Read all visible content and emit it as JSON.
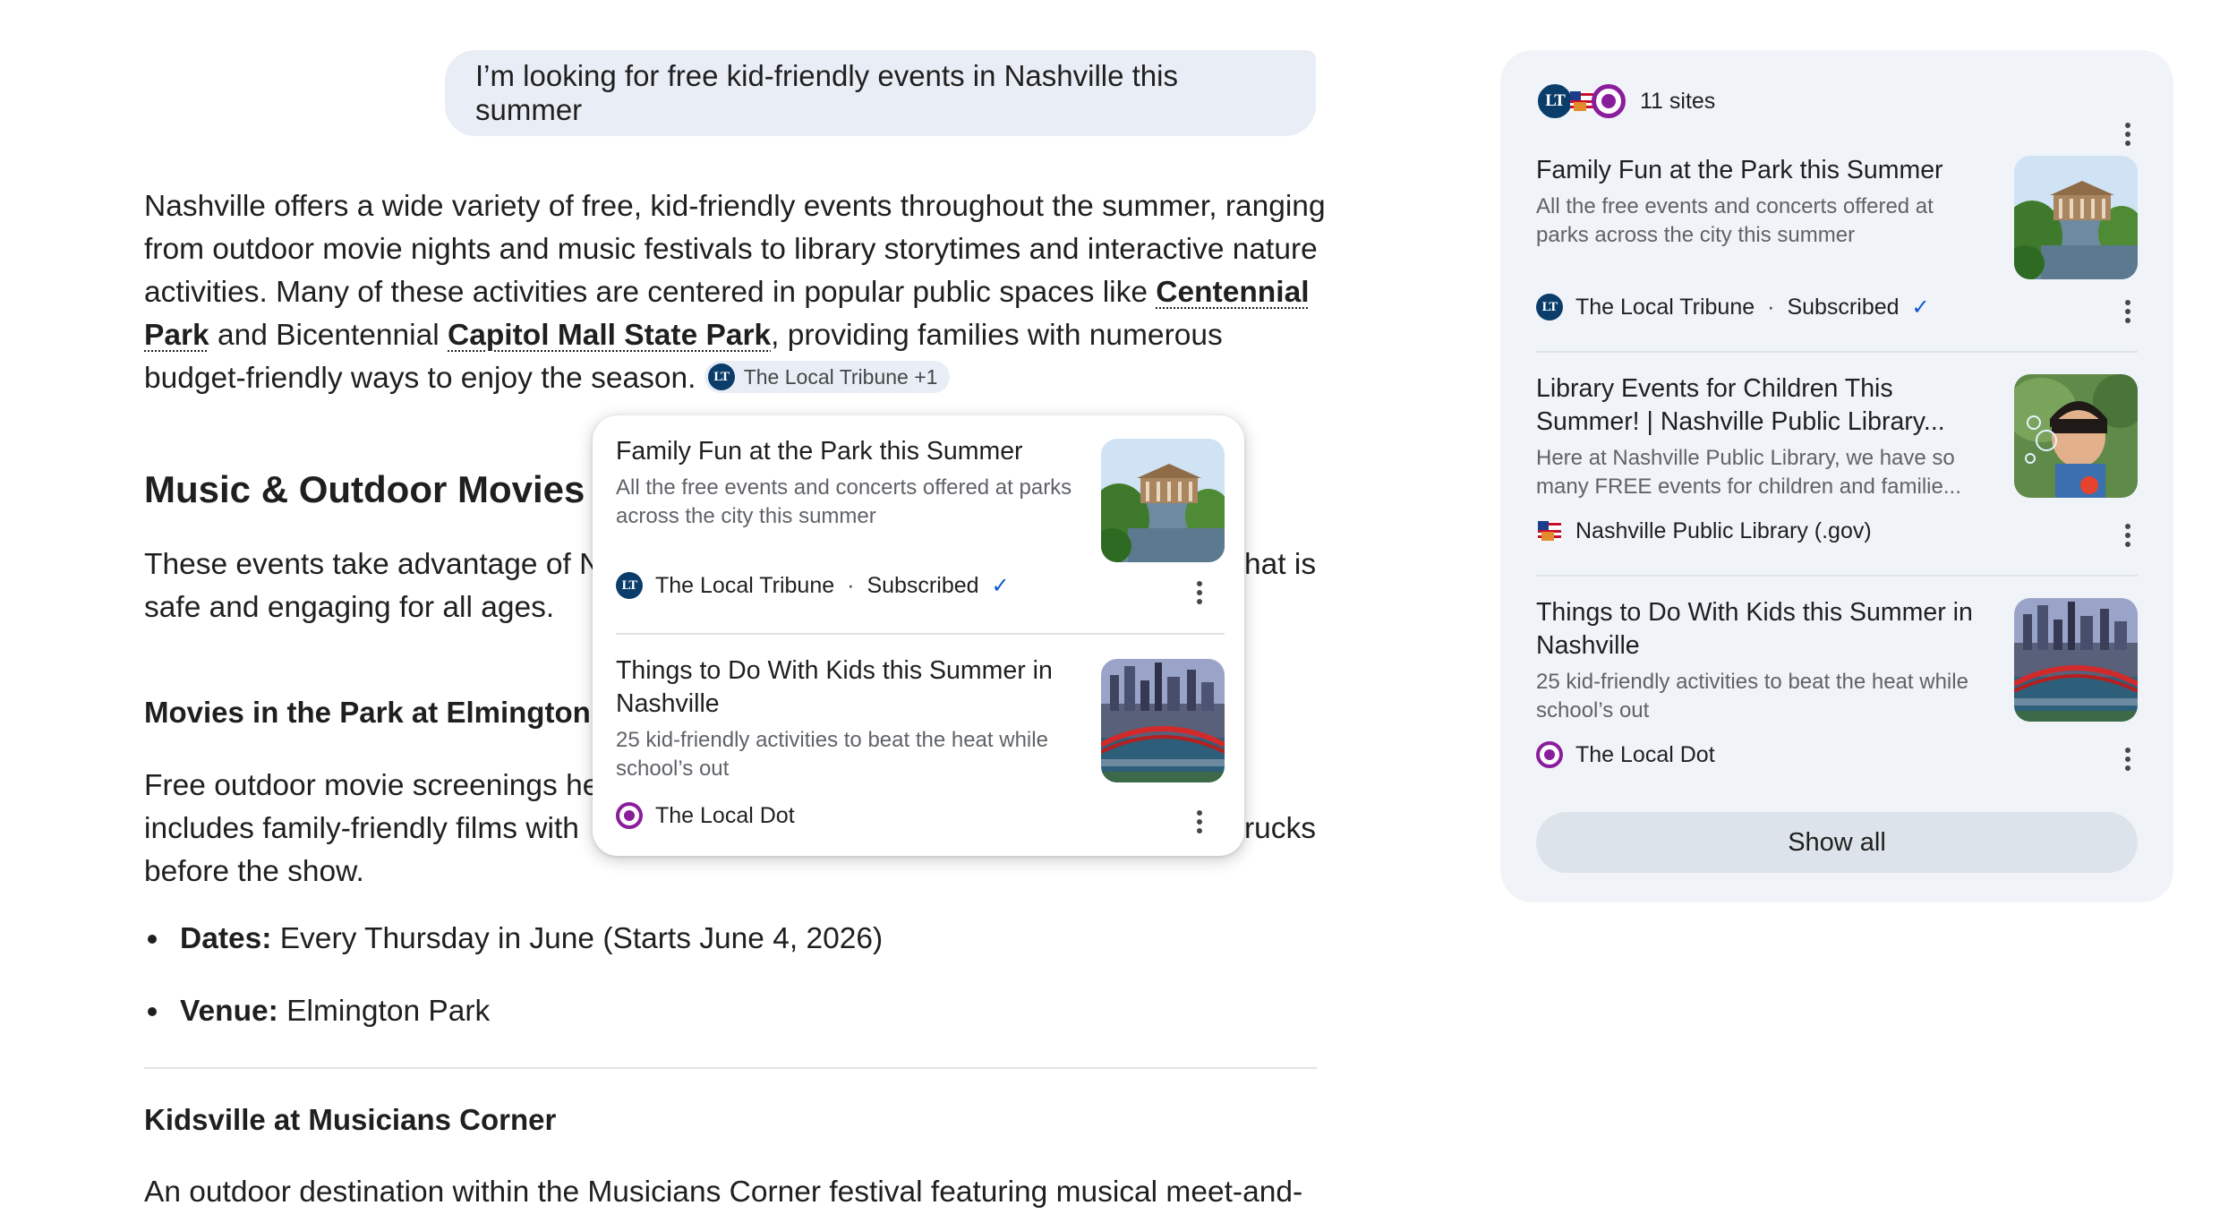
{
  "query": "I’m looking for free kid-friendly events in Nashville this summer",
  "intro": {
    "part1": "Nashville offers a wide variety of free, kid-friendly events throughout the summer, ranging from outdoor movie nights and music festivals to library storytimes and interactive nature activities. Many of these activities are centered in popular public spaces like ",
    "link1": "Centennial Park",
    "part2": " and Bicentennial ",
    "link2": "Capitol Mall State Park",
    "part3": ", providing families with numerous budget-friendly ways to enjoy the season.",
    "chip_label": "The Local Tribune +1"
  },
  "section1": {
    "heading": "Music & Outdoor Movies",
    "body_left": "These events take advantage of Na",
    "body_right": "hat is",
    "body_line2": "safe and engaging for all ages."
  },
  "section2": {
    "heading": "Movies in the Park at Elmington",
    "line1_left": "Free outdoor movie screenings hel",
    "line2_left": "includes family-friendly films with",
    "line2_right": "rucks",
    "line3": "before the show.",
    "bullets": [
      {
        "label": "Dates:",
        "value": " Every Thursday in June (Starts June 4, 2026)"
      },
      {
        "label": "Venue:",
        "value": " Elmington Park"
      }
    ]
  },
  "section3": {
    "heading": "Kidsville at Musicians Corner",
    "line1": "An outdoor destination within the Musicians Corner festival featuring musical meet-and-"
  },
  "popup": {
    "cards": [
      {
        "title": "Family Fun at the Park this Summer",
        "desc": "All the free events and concerts offered at parks across the city this summer",
        "source": "The Local Tribune",
        "sep": "·",
        "status": "Subscribed",
        "check": "✓"
      },
      {
        "title": "Things to Do With Kids this Summer in Nashville",
        "desc": "25 kid-friendly activities to beat the heat while school’s out",
        "source": "The Local Dot"
      }
    ]
  },
  "panel": {
    "sites_label": "11 sites",
    "cards": [
      {
        "title": "Family Fun at the Park this Summer",
        "desc": "All the free events and concerts offered at parks across the city this summer",
        "source": "The Local Tribune",
        "sep": "·",
        "status": "Subscribed",
        "check": "✓"
      },
      {
        "title": "Library Events for Children This Summer! | Nashville Public Library...",
        "desc": "Here at Nashville Public Library, we have so many FREE events for children and familie...",
        "source": "Nashville Public Library (.gov)"
      },
      {
        "title": "Things to Do With Kids this Summer in Nashville",
        "desc": "25 kid-friendly activities to beat the heat while school’s out",
        "source": "The Local Dot"
      }
    ],
    "show_all": "Show all"
  },
  "logos": {
    "lt_text": "LT"
  },
  "colors": {
    "bubble": "#e9eef6",
    "panel": "#f0f4f9",
    "accent_blue": "#0b57d0",
    "tribune_navy": "#0b3d6b",
    "dot_purple": "#8a1d9c"
  }
}
